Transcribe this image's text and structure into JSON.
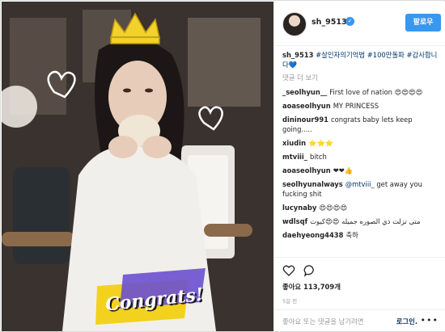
{
  "post": {
    "username": "sh_9513",
    "verified": true,
    "follow_label": "팔로우"
  },
  "caption": {
    "username": "sh_9513",
    "text": "#살인자의기억법 #100만돌파 #감사합니다💙"
  },
  "load_more_label": "댓글 더 보기",
  "comments": [
    {
      "user": "_seolhyun__",
      "text": "First love of nation 😍😍😍😍"
    },
    {
      "user": "aoaseolhyun",
      "text": "MY PRINCESS"
    },
    {
      "user": "dininour991",
      "text": "congrats baby lets keep going....."
    },
    {
      "user": "xiudin",
      "text": "⭐⭐⭐"
    },
    {
      "user": "mtviii_",
      "text": "bitch"
    },
    {
      "user": "aoaseolhyun",
      "text": "❤❤👍"
    },
    {
      "user": "seolhyunalways",
      "mention": "@mtviii_",
      "text": "get away you fucking shit"
    },
    {
      "user": "lucynaby",
      "text": "😍😍😍😍"
    },
    {
      "user": "wdlsqf",
      "text": "متى تزلت ذي الصوره جميله 😍😍كيوت"
    },
    {
      "user": "daehyeong4438",
      "text": "축하"
    }
  ],
  "likes": {
    "label": "좋아요",
    "count": "113,709개"
  },
  "timestamp": "5일 전",
  "add_comment": {
    "placeholder": "좋아요 또는 댓글을 남기려면",
    "login_label": "로그인."
  },
  "photo": {
    "sticker_text": "Congrats!"
  },
  "icons": {
    "like": "heart-icon",
    "comment": "comment-icon",
    "more": "more-icon"
  },
  "colors": {
    "accent": "#3897f0",
    "hashtag": "#003569",
    "muted": "#999999"
  }
}
